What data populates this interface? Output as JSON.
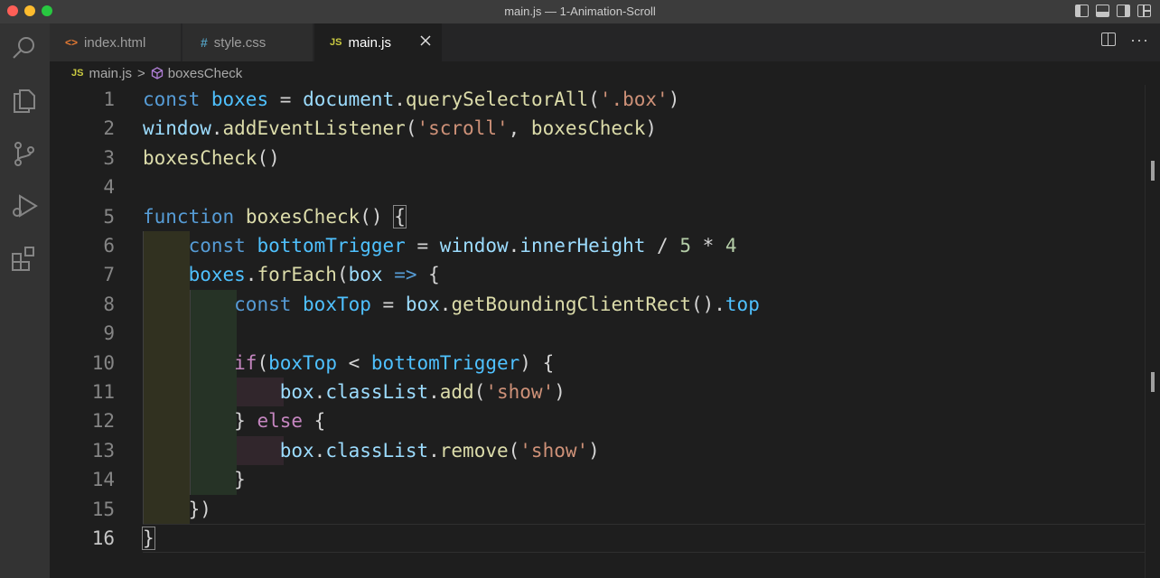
{
  "window": {
    "title": "main.js — 1-Animation-Scroll"
  },
  "tabs": [
    {
      "label": "index.html",
      "icon": "<>",
      "icon_name": "html-file-icon",
      "active": false
    },
    {
      "label": "style.css",
      "icon": "#",
      "icon_name": "css-file-icon",
      "active": false
    },
    {
      "label": "main.js",
      "icon": "JS",
      "icon_name": "js-file-icon",
      "active": true
    }
  ],
  "tab_actions": {
    "more": "···"
  },
  "breadcrumb": {
    "file_icon": "JS",
    "file": "main.js",
    "separator": ">",
    "symbol": "boxesCheck"
  },
  "editor": {
    "current_line": 16,
    "line_numbers": [
      "1",
      "2",
      "3",
      "4",
      "5",
      "6",
      "7",
      "8",
      "9",
      "10",
      "11",
      "12",
      "13",
      "14",
      "15",
      "16"
    ]
  },
  "colors": {
    "keyword": "#569cd6",
    "control": "#c586c0",
    "variable": "#4fc1ff",
    "property": "#9cdcfe",
    "function": "#dcdcaa",
    "string": "#ce9178",
    "number": "#b5cea8"
  }
}
